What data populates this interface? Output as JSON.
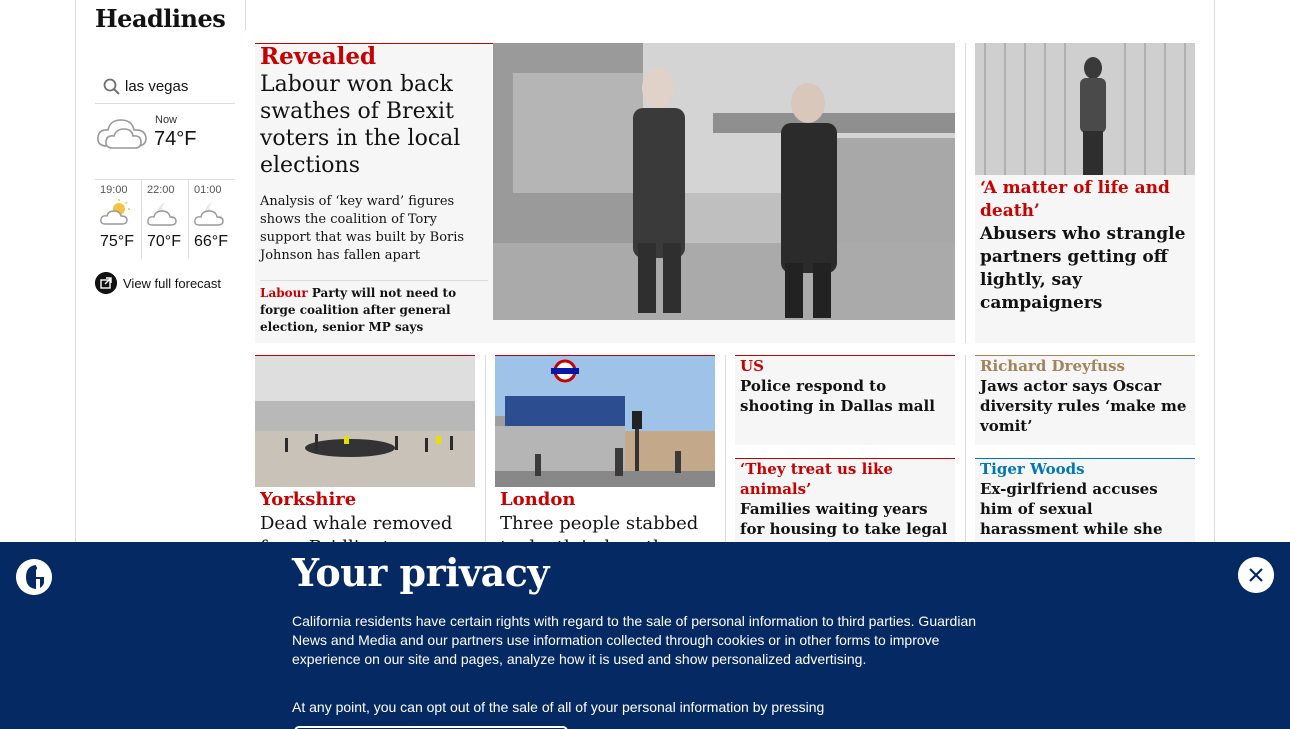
{
  "section": {
    "title": "Headlines"
  },
  "weather": {
    "location": "las vegas",
    "now_label": "Now",
    "now_temp": "74°F",
    "forecast": [
      {
        "time": "19:00",
        "temp": "75°F",
        "icon": "partly-sunny-icon"
      },
      {
        "time": "22:00",
        "temp": "70°F",
        "icon": "cloudy-night-icon"
      },
      {
        "time": "01:00",
        "temp": "66°F",
        "icon": "cloudy-night-icon"
      }
    ],
    "view_full": "View full forecast"
  },
  "lead": {
    "kicker": "Revealed",
    "headline": "Labour won back swathes of Brexit voters in the local elections",
    "standfirst": "Analysis of ‘key ward’ figures shows the coalition of Tory support that was built by Boris Johnson has fallen apart",
    "sub_kicker": "Labour",
    "sub_headline": "Party will not need to forge coalition after general election, senior MP says"
  },
  "side_story": {
    "kicker": "‘A matter of life and death’",
    "headline": "Abusers who strangle partners getting off lightly, say campaigners"
  },
  "row2": [
    {
      "kicker": "Yorkshire",
      "headline": "Dead whale removed from Bridlington"
    },
    {
      "kicker": "London",
      "headline": "Three people stabbed to death in breath"
    }
  ],
  "small_stories": [
    {
      "kicker": "US",
      "headline": "Police respond to shooting in Dallas mall"
    },
    {
      "kicker": "‘They treat us like animals’",
      "headline": "Families waiting years for housing to take legal"
    },
    {
      "kicker": "Richard Dreyfuss",
      "headline": "Jaws actor says Oscar diversity rules ‘make me vomit’"
    },
    {
      "kicker": "Tiger Woods",
      "headline": "Ex-girlfriend accuses him of sexual harassment while she was his employee"
    }
  ],
  "privacy": {
    "title": "Your privacy",
    "para1": "California residents have certain rights with regard to the sale of personal information to third parties. Guardian News and Media and our partners use information collected through cookies or in other forms to improve experience on our site and pages, analyze how it is used and show personalized advertising.",
    "para2": "At any point, you can opt out of the sale of all of your personal information by pressing"
  }
}
